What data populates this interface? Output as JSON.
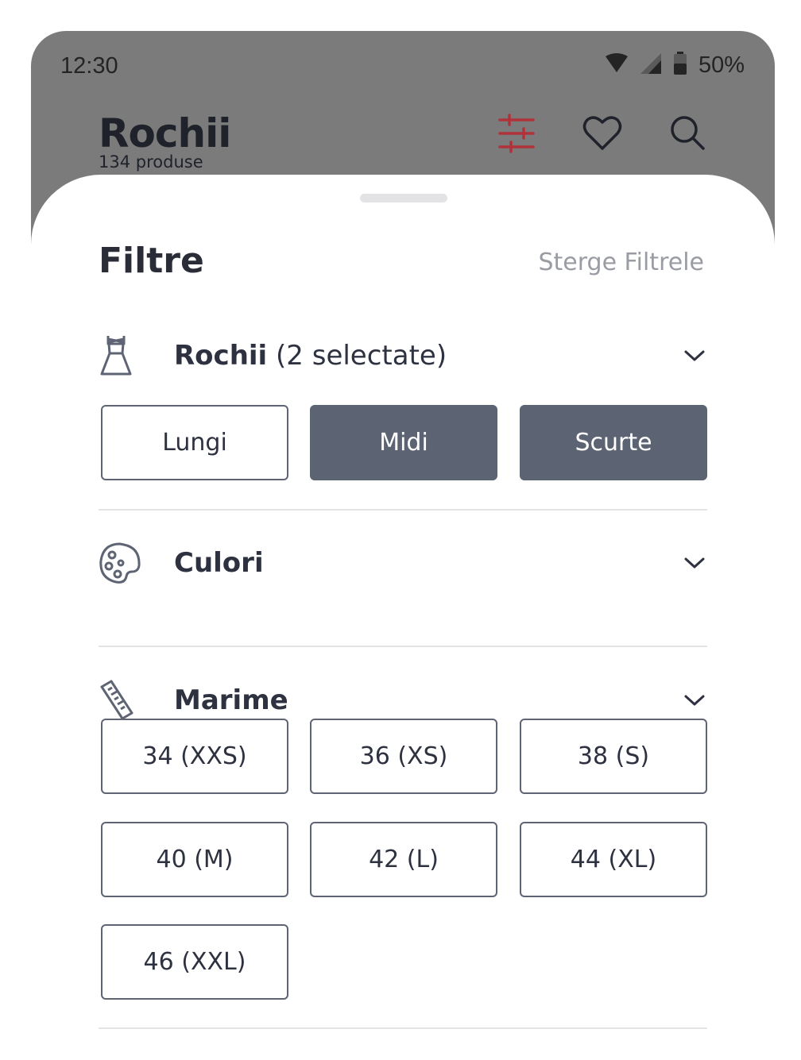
{
  "status_bar": {
    "time": "12:30",
    "battery": "50%",
    "icons": [
      "wifi-icon",
      "signal-icon",
      "battery-icon"
    ]
  },
  "app_bar": {
    "title": "Rochii",
    "subtitle": "134 produse",
    "actions": [
      "filter-sliders-icon",
      "heart-icon",
      "search-icon"
    ],
    "accent_color": "#b0323a"
  },
  "sheet": {
    "title": "Filtre",
    "clear_label": "Sterge Filtrele",
    "sections": [
      {
        "icon": "dress-icon",
        "label": "Rochii",
        "suffix": " (2 selectate)",
        "options": [
          {
            "label": "Lungi",
            "selected": false
          },
          {
            "label": "Midi",
            "selected": true
          },
          {
            "label": "Scurte",
            "selected": true
          }
        ]
      },
      {
        "icon": "palette-icon",
        "label": "Culori",
        "suffix": ""
      },
      {
        "icon": "ruler-icon",
        "label": "Marime",
        "suffix": "",
        "options": [
          {
            "label": "34 (XXS)",
            "selected": false
          },
          {
            "label": "36 (XS)",
            "selected": false
          },
          {
            "label": "38 (S)",
            "selected": false
          },
          {
            "label": "40 (M)",
            "selected": false
          },
          {
            "label": "42 (L)",
            "selected": false
          },
          {
            "label": "44 (XL)",
            "selected": false
          },
          {
            "label": "46 (XXL)",
            "selected": false
          }
        ]
      }
    ]
  },
  "colors": {
    "selected_chip": "#5c6474",
    "scrim": "#7b7b7b",
    "text": "#2e3240"
  }
}
